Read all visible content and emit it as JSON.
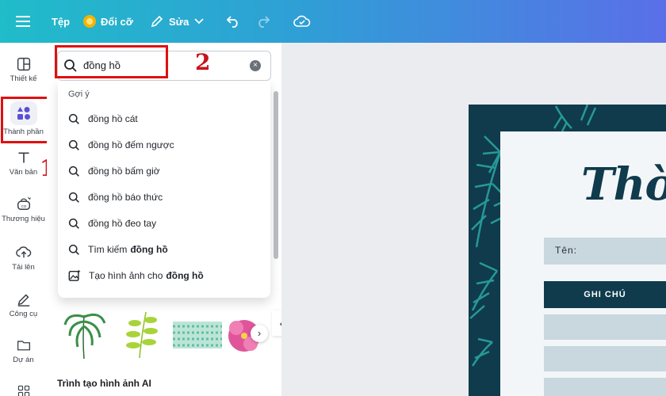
{
  "topbar": {
    "file_label": "Tệp",
    "resize_label": "Đổi cỡ",
    "edit_label": "Sửa"
  },
  "rail": {
    "items": [
      {
        "label": "Thiết kế",
        "icon": "layout-icon"
      },
      {
        "label": "Thành phần",
        "icon": "elements-icon"
      },
      {
        "label": "Văn bản",
        "icon": "text-icon"
      },
      {
        "label": "Thương hiệu",
        "icon": "brand-icon"
      },
      {
        "label": "Tải lên",
        "icon": "upload-cloud-icon"
      },
      {
        "label": "Công cụ",
        "icon": "draw-tools-icon"
      },
      {
        "label": "Dự án",
        "icon": "folder-icon"
      }
    ]
  },
  "annotations": {
    "step1": "1",
    "step2": "2"
  },
  "search": {
    "value": "đồng hồ"
  },
  "suggestions": {
    "heading": "Gợi ý",
    "items": [
      "đồng hồ cát",
      "đồng hồ đếm ngược",
      "đồng hồ bấm giờ",
      "đồng hồ báo thức",
      "đồng hồ đeo tay"
    ],
    "search_prefix": "Tìm kiếm",
    "search_term": "đồng hồ",
    "ai_prefix": "Tạo hình ảnh cho",
    "ai_term": "đồng hồ"
  },
  "panel": {
    "ai_section_title": "Trình tạo hình ảnh AI"
  },
  "design": {
    "title": "Thời",
    "name_label": "Tên:",
    "notes_label": "GHI CHÚ"
  },
  "colors": {
    "topbar_start": "#20bcc9",
    "topbar_end": "#5a6fe8",
    "design_dark": "#0f3b4d",
    "annotation_red": "#e01010"
  }
}
